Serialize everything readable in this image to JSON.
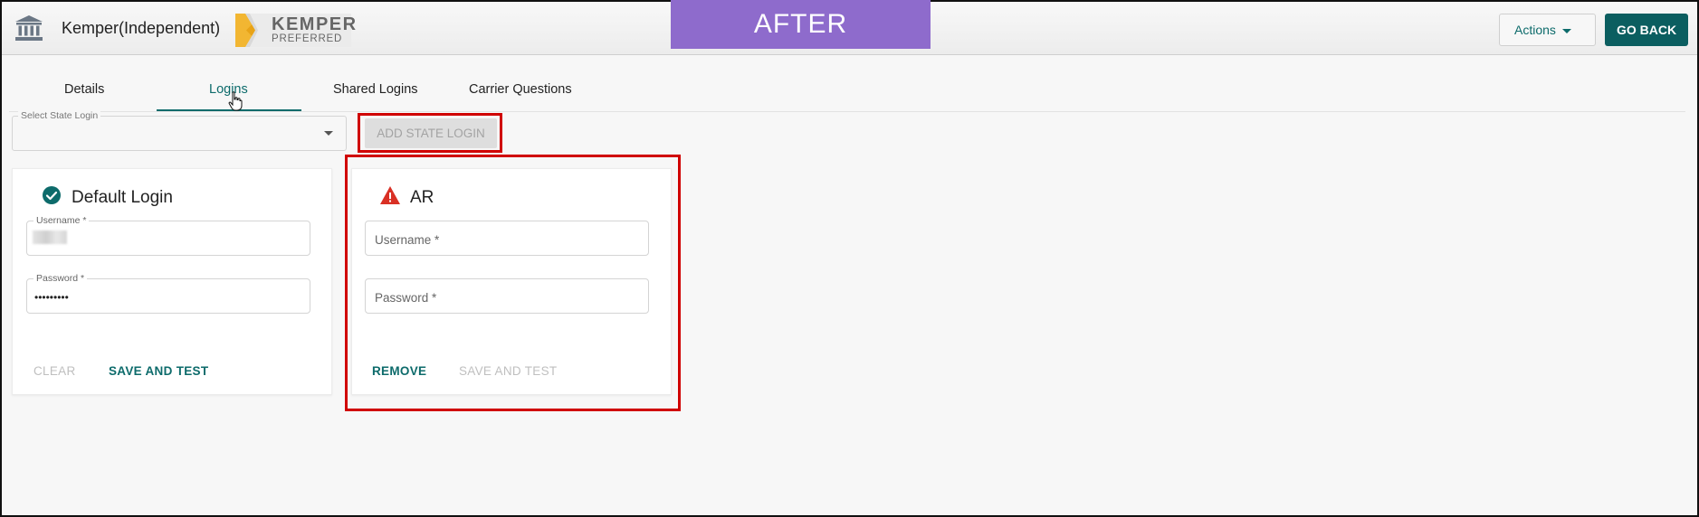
{
  "header": {
    "org_name": "Kemper(Independent)",
    "logo": {
      "line1": "KEMPER",
      "line2": "PREFERRED"
    },
    "banner": "AFTER",
    "actions_label": "Actions",
    "go_back_label": "GO BACK"
  },
  "tabs": [
    {
      "label": "Details",
      "active": false
    },
    {
      "label": "Logins",
      "active": true
    },
    {
      "label": "Shared Logins",
      "active": false
    },
    {
      "label": "Carrier Questions",
      "active": false
    }
  ],
  "state_select": {
    "label": "Select State Login",
    "value": ""
  },
  "add_state_button": "ADD STATE LOGIN",
  "default_card": {
    "title": "Default Login",
    "username_label": "Username *",
    "password_label": "Password *",
    "password_value": "•••••••••",
    "clear_label": "CLEAR",
    "save_label": "SAVE AND TEST"
  },
  "ar_card": {
    "title": "AR",
    "username_placeholder": "Username *",
    "password_placeholder": "Password *",
    "remove_label": "REMOVE",
    "save_label": "SAVE AND TEST"
  },
  "colors": {
    "teal": "#0d6b6b",
    "go_back_bg": "#0b5e60",
    "banner_bg": "#8e6bcc",
    "highlight_red": "#d00000",
    "warning_red": "#d93025"
  },
  "icons": [
    "bank-icon",
    "kemper-logo",
    "chevron-down-icon",
    "pointer-cursor-icon",
    "check-circle-icon",
    "warning-icon"
  ]
}
